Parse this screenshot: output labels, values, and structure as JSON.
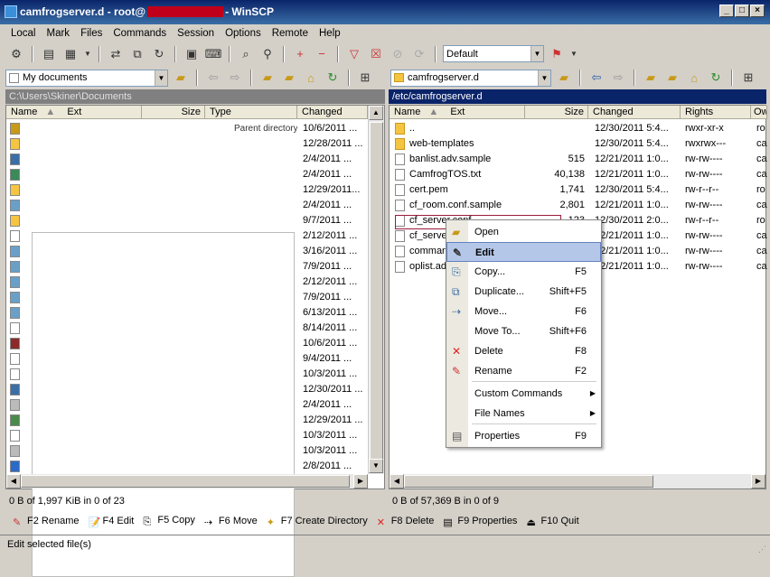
{
  "window": {
    "title_prefix": "camfrogserver.d - root@",
    "title_suffix": "- WinSCP"
  },
  "menu": [
    "Local",
    "Mark",
    "Files",
    "Commands",
    "Session",
    "Options",
    "Remote",
    "Help"
  ],
  "toolbar": {
    "transfer_preset": "Default"
  },
  "left": {
    "location": "My documents",
    "path": "C:\\Users\\Skiner\\Documents",
    "columns": [
      "Name",
      "Ext",
      "Size",
      "Type",
      "Changed"
    ],
    "first_type": "Parent directory",
    "changed": [
      "10/6/2011 ...",
      "12/28/2011 ...",
      "2/4/2011 ...",
      "2/4/2011 ...",
      "12/29/2011...",
      "2/4/2011 ...",
      "9/7/2011 ...",
      "2/12/2011 ...",
      "3/16/2011 ...",
      "7/9/2011 ...",
      "2/12/2011 ...",
      "7/9/2011 ...",
      "6/13/2011 ...",
      "8/14/2011 ...",
      "10/6/2011 ...",
      "9/4/2011 ...",
      "10/3/2011 ...",
      "12/30/2011 ...",
      "2/4/2011 ...",
      "12/29/2011 ...",
      "10/3/2011 ...",
      "10/3/2011 ...",
      "2/8/2011 ..."
    ],
    "status": "0 B of 1,997 KiB in 0 of 23"
  },
  "right": {
    "location": "camfrogserver.d",
    "path": "/etc/camfrogserver.d",
    "columns": [
      "Name",
      "Ext",
      "Size",
      "Changed",
      "Rights",
      "Ow"
    ],
    "rows": [
      {
        "name": "..",
        "size": "",
        "changed": "12/30/2011 5:4...",
        "rights": "rwxr-xr-x",
        "owner": "ro",
        "icon": "parent-folder-icon"
      },
      {
        "name": "web-templates",
        "size": "",
        "changed": "12/30/2011 5:4...",
        "rights": "rwxrwx---",
        "owner": "ca",
        "icon": "folder-icon"
      },
      {
        "name": "banlist.adv.sample",
        "size": "515",
        "changed": "12/21/2011 1:0...",
        "rights": "rw-rw----",
        "owner": "ca",
        "icon": "file-icon"
      },
      {
        "name": "CamfrogTOS.txt",
        "size": "40,138",
        "changed": "12/21/2011 1:0...",
        "rights": "rw-rw----",
        "owner": "ca",
        "icon": "file-icon"
      },
      {
        "name": "cert.pem",
        "size": "1,741",
        "changed": "12/30/2011 5:4...",
        "rights": "rw-r--r--",
        "owner": "ro",
        "icon": "file-icon"
      },
      {
        "name": "cf_room.conf.sample",
        "size": "2,801",
        "changed": "12/21/2011 1:0...",
        "rights": "rw-rw----",
        "owner": "ca",
        "icon": "file-icon"
      },
      {
        "name": "cf_server.conf",
        "size": "123",
        "changed": "12/30/2011 2:0...",
        "rights": "rw-r--r--",
        "owner": "ro",
        "icon": "file-icon"
      },
      {
        "name": "cf_serve",
        "size": "",
        "changed": "12/21/2011 1:0...",
        "rights": "rw-rw----",
        "owner": "ca",
        "icon": "file-icon"
      },
      {
        "name": "command",
        "size": "",
        "changed": "12/21/2011 1:0...",
        "rights": "rw-rw----",
        "owner": "ca",
        "icon": "file-icon"
      },
      {
        "name": "oplist.ad",
        "size": "",
        "changed": "12/21/2011 1:0...",
        "rights": "rw-rw----",
        "owner": "ca",
        "icon": "file-icon"
      }
    ],
    "status": "0 B of 57,369 B in 0 of 9"
  },
  "context_menu": [
    {
      "label": "Open",
      "shortcut": "",
      "icon": "open-folder-icon"
    },
    {
      "label": "Edit",
      "shortcut": "",
      "icon": "edit-icon",
      "selected": true
    },
    {
      "label": "Copy...",
      "shortcut": "F5",
      "icon": "copy-icon"
    },
    {
      "label": "Duplicate...",
      "shortcut": "Shift+F5",
      "icon": "duplicate-icon"
    },
    {
      "label": "Move...",
      "shortcut": "F6",
      "icon": "move-icon"
    },
    {
      "label": "Move To...",
      "shortcut": "Shift+F6",
      "icon": ""
    },
    {
      "label": "Delete",
      "shortcut": "F8",
      "icon": "delete-icon"
    },
    {
      "label": "Rename",
      "shortcut": "F2",
      "icon": "rename-icon"
    },
    {
      "label": "Custom Commands",
      "shortcut": "",
      "submenu": true
    },
    {
      "label": "File Names",
      "shortcut": "",
      "submenu": true
    },
    {
      "label": "Properties",
      "shortcut": "F9",
      "icon": "properties-icon"
    }
  ],
  "fkeys": [
    "F2 Rename",
    "F4 Edit",
    "F5 Copy",
    "F6 Move",
    "F7 Create Directory",
    "F8 Delete",
    "F9 Properties",
    "F10 Quit"
  ],
  "statusbar": "Edit selected file(s)",
  "colors": {
    "title_bg": "#0a246a",
    "selection_bg": "#b5c7e8",
    "path_active": "#0a246a",
    "highlight_box": "#9a1b3a"
  }
}
